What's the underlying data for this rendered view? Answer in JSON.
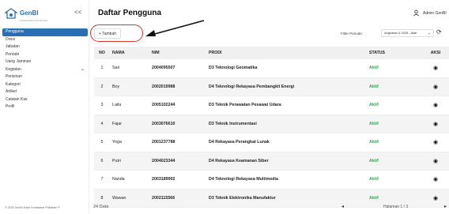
{
  "sidebar": {
    "brand": "GenBI",
    "brand_sub": "KOMISARIAT POLBATAM",
    "collapse": "<<",
    "items": [
      {
        "label": "Pengguna",
        "active": true
      },
      {
        "label": "Divisi"
      },
      {
        "label": "Jabatan"
      },
      {
        "label": "Periode"
      },
      {
        "label": "Uang Jaminan"
      },
      {
        "label": "Kegiatan",
        "chevron": "⌄"
      },
      {
        "label": "Perizinan"
      },
      {
        "label": "Kategori"
      },
      {
        "label": "Artikel"
      },
      {
        "label": "Catatan Kas"
      },
      {
        "label": "Profil"
      }
    ],
    "copyright": "© 2025 GenBI Kepri Komisariat Polbatam™"
  },
  "header": {
    "title": "Daftar Pengguna",
    "admin": "Admin GenBI"
  },
  "toolbar": {
    "add_label": "+ Tambah",
    "filter_label": "Filter Periode:",
    "filter_value": "Angkatan 4 2025 - Aktif",
    "refresh": "⟳"
  },
  "table": {
    "headers": {
      "no": "NO",
      "nama": "NAMA",
      "nim": "NIM",
      "prodi": "PRODI",
      "status": "STATUS",
      "aksi": "AKSI"
    },
    "rows": [
      {
        "no": "1",
        "nama": "Sari",
        "nim": "2004095507",
        "prodi": "D3 Teknologi Geomatika",
        "status": "Aktif"
      },
      {
        "no": "2",
        "nama": "Boy",
        "nim": "2002019988",
        "prodi": "D4 Teknologi Rekayasa Pembangkit Energi",
        "status": "Aktif"
      },
      {
        "no": "3",
        "nama": "Laila",
        "nim": "2005102244",
        "prodi": "D3 Teknik Perawatan Pesawat Udara",
        "status": "Aktif"
      },
      {
        "no": "4",
        "nama": "Fajar",
        "nim": "2003076610",
        "prodi": "D3 Teknik Instrumentasi",
        "status": "Aktif"
      },
      {
        "no": "5",
        "nama": "Yoga",
        "nim": "2001237788",
        "prodi": "D4 Rekayasa Perangkat Lunak",
        "status": "Aktif"
      },
      {
        "no": "6",
        "nama": "Putri",
        "nim": "2004023344",
        "prodi": "D4 Rekayasa Keamanan Siber",
        "status": "Aktif"
      },
      {
        "no": "7",
        "nama": "Nanda",
        "nim": "2003189902",
        "prodi": "D4 Teknologi Rekayasa Multimedia",
        "status": "Aktif"
      },
      {
        "no": "8",
        "nama": "Wawan",
        "nim": "2002115566",
        "prodi": "D3 Teknik Elektronika Manufaktur",
        "status": "Aktif"
      }
    ]
  },
  "footer": {
    "count": "24 Data",
    "prev": "◂",
    "page": "Halaman 1 / 3",
    "next": "▸"
  },
  "colors": {
    "primary": "#2a6fb4",
    "status_active": "#2eaa4d",
    "annotation": "#d9342b"
  }
}
